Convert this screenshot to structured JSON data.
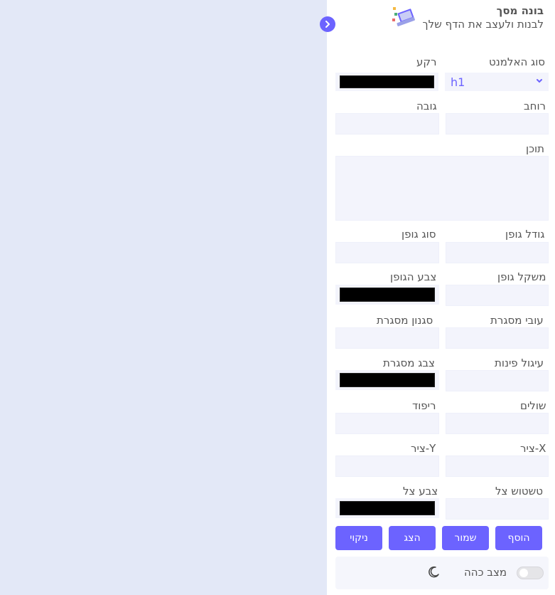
{
  "app": {
    "title": "בונה מסך",
    "subtitle": "לבנות ולעצב את הדף שלך"
  },
  "form": {
    "element_type_label": "סוג האלמנט",
    "element_type_value": "h1",
    "background_label": "רקע",
    "width_label": "רוחב",
    "height_label": "גובה",
    "content_label": "תוכן",
    "font_size_label": "גודל גופן",
    "font_family_label": "סוג גופן",
    "font_weight_label": "משקל גופן",
    "font_color_label": "צבע הגופן",
    "border_width_label": "עובי מסגרת",
    "border_style_label": "סגנון מסגרת",
    "border_radius_label": "עיגול פינות",
    "border_color_label": "צבג מסגרת",
    "margin_label": "שולים",
    "padding_label": "ריפוד",
    "shadow_x_label": "ציר-X",
    "shadow_y_label": "ציר-Y",
    "shadow_blur_label": "טשטוש צל",
    "shadow_color_label": "צבע צל"
  },
  "buttons": {
    "add": "הוסף",
    "save": "שמור",
    "show": "הצג",
    "clear": "ניקוי"
  },
  "dark_mode": {
    "label": "מצב כהה",
    "enabled": false
  },
  "colors": {
    "accent": "#6c63ff",
    "canvas": "#e3e8f7",
    "input_bg": "#f3f4fc"
  }
}
